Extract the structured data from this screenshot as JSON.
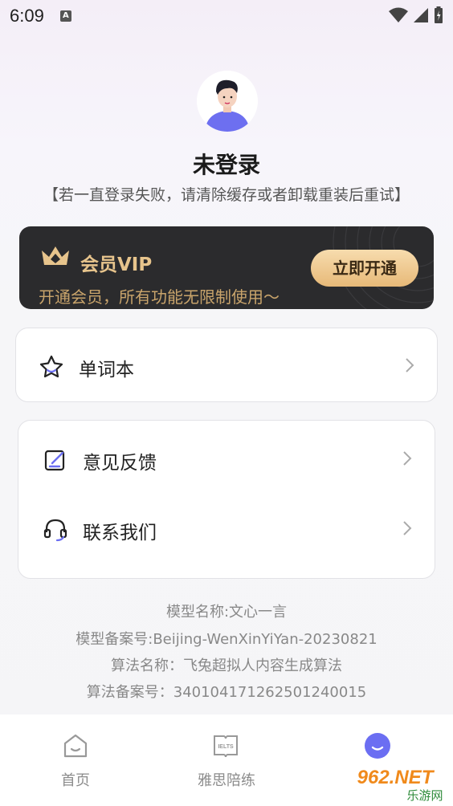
{
  "status_bar": {
    "time": "6:09",
    "notification_letter": "A"
  },
  "profile": {
    "username": "未登录",
    "hint": "【若一直登录失败，请清除缓存或者卸载重装后重试】"
  },
  "vip": {
    "title": "会员VIP",
    "subtitle": "开通会员，所有功能无限制使用～",
    "button": "立即开通"
  },
  "menu": {
    "wordbook": "单词本",
    "feedback": "意见反馈",
    "contact": "联系我们"
  },
  "info": {
    "model_name": "模型名称:文心一言",
    "model_record": "模型备案号:Beijing-WenXinYiYan-20230821",
    "algo_name": "算法名称：飞兔超拟人内容生成算法",
    "algo_record": "算法备案号：340104171262501240015"
  },
  "tabs": [
    {
      "label": "首页"
    },
    {
      "label": "雅思陪练",
      "icon_text": "IELTS"
    },
    {
      "label": ""
    }
  ],
  "watermark": {
    "line1": "962.NET",
    "line2": "乐游网"
  },
  "colors": {
    "vip_gold": "#e7c48c",
    "vip_bg": "#2b2b2d",
    "accent_purple": "#6b6ef2"
  }
}
